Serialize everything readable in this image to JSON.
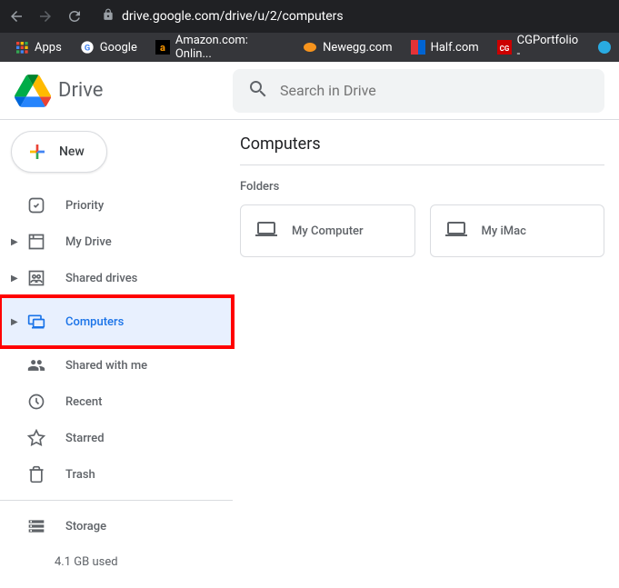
{
  "browser": {
    "url": "drive.google.com/drive/u/2/computers",
    "bookmarks": [
      {
        "label": "Apps",
        "icon": "apps"
      },
      {
        "label": "Google",
        "icon": "google"
      },
      {
        "label": "Amazon.com: Onlin...",
        "icon": "amazon"
      },
      {
        "label": "Newegg.com",
        "icon": "newegg"
      },
      {
        "label": "Half.com",
        "icon": "half"
      },
      {
        "label": "CGPortfolio -",
        "icon": "cg"
      }
    ]
  },
  "app": {
    "name": "Drive",
    "search_placeholder": "Search in Drive"
  },
  "sidebar": {
    "new_label": "New",
    "items": [
      {
        "label": "Priority",
        "icon": "priority"
      },
      {
        "label": "My Drive",
        "icon": "mydrive",
        "expandable": true
      },
      {
        "label": "Shared drives",
        "icon": "shared_drives",
        "expandable": true
      },
      {
        "label": "Computers",
        "icon": "computers",
        "expandable": true,
        "active": true
      },
      {
        "label": "Shared with me",
        "icon": "shared"
      },
      {
        "label": "Recent",
        "icon": "recent"
      },
      {
        "label": "Starred",
        "icon": "starred"
      },
      {
        "label": "Trash",
        "icon": "trash"
      }
    ],
    "storage_label": "Storage",
    "storage_used": "4.1 GB used"
  },
  "content": {
    "title": "Computers",
    "section_label": "Folders",
    "folders": [
      {
        "name": "My Computer"
      },
      {
        "name": "My iMac"
      }
    ]
  }
}
